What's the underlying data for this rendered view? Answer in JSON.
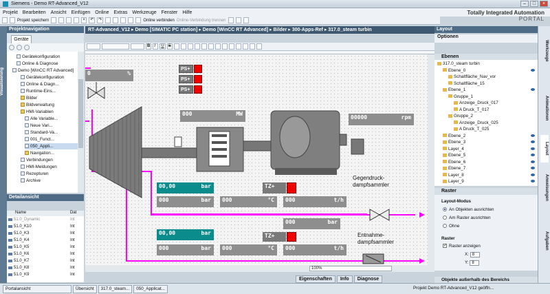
{
  "window": {
    "title": "Siemens - Demo RT-Advanced_V12"
  },
  "menu": [
    "Projekt",
    "Bearbeiten",
    "Ansicht",
    "Einfügen",
    "Online",
    "Extras",
    "Werkzeuge",
    "Fenster",
    "Hilfe"
  ],
  "brand": {
    "line1": "Totally Integrated Automation",
    "line2": "PORTAL"
  },
  "toolbar": {
    "save": "Projekt speichern",
    "connect": "Online verbinden",
    "disconnect": "Online-Verbindung trennen"
  },
  "left_strip": "Visualisierung",
  "project_nav": {
    "title": "Projektnavigation",
    "tab": "Geräte",
    "tree": [
      {
        "label": "Gerätekonfiguration",
        "indent": 2,
        "icon": "device"
      },
      {
        "label": "Online & Diagnose",
        "indent": 2,
        "icon": "device"
      },
      {
        "label": "Demo [WinCC RT Advanced]",
        "indent": 1,
        "icon": "device"
      },
      {
        "label": "Gerätekonfiguration",
        "indent": 3,
        "icon": "device"
      },
      {
        "label": "Online & Diagn...",
        "indent": 3,
        "icon": "device"
      },
      {
        "label": "Runtime-Eins...",
        "indent": 3,
        "icon": "device"
      },
      {
        "label": "Bilder",
        "indent": 3,
        "icon": "folder"
      },
      {
        "label": "Bildverwaltung",
        "indent": 3,
        "icon": "folder"
      },
      {
        "label": "HMI-Variablen",
        "indent": 3,
        "icon": "folder"
      },
      {
        "label": "Alle Variable...",
        "indent": 4,
        "icon": "device"
      },
      {
        "label": "Neue Vari...",
        "indent": 4,
        "icon": "device"
      },
      {
        "label": "Standard-Va...",
        "indent": 4,
        "icon": "device"
      },
      {
        "label": "001_Funct...",
        "indent": 4,
        "icon": "device"
      },
      {
        "label": "050_Appli...",
        "indent": 4,
        "icon": "device",
        "selected": true
      },
      {
        "label": "Navigation...",
        "indent": 4,
        "icon": "folder"
      },
      {
        "label": "Verbindungen",
        "indent": 3,
        "icon": "device"
      },
      {
        "label": "HMI-Meldungen",
        "indent": 3,
        "icon": "device"
      },
      {
        "label": "Rezepturen",
        "indent": 3,
        "icon": "device"
      },
      {
        "label": "Archive",
        "indent": 3,
        "icon": "device"
      }
    ]
  },
  "detail": {
    "title": "Detailansicht",
    "col_name": "Name",
    "col_type": "Dat",
    "rows": [
      {
        "name": "51.0_Dynamic",
        "type": "Int"
      },
      {
        "name": "51.0_K10",
        "type": "Int"
      },
      {
        "name": "51.0_K3",
        "type": "Int"
      },
      {
        "name": "51.0_K4",
        "type": "Int"
      },
      {
        "name": "51.0_K5",
        "type": "Int"
      },
      {
        "name": "51.0_K6",
        "type": "Int"
      },
      {
        "name": "51.0_K7",
        "type": "Int"
      },
      {
        "name": "51.0_K8",
        "type": "Int"
      },
      {
        "name": "51.0_K9",
        "type": "Int"
      }
    ]
  },
  "breadcrumb": "RT-Advanced_V12  ▸  Demo [SIMATIC PC station]  ▸  Demo [WinCC RT Advanced]  ▸  Bilder  ▸  300-Apps-Ref  ▸  317.0_steam turbin",
  "fmt": {
    "bold": "B",
    "italic": "I",
    "underline": "U",
    "strike": "S"
  },
  "zoom": "100%",
  "bottom_tabs": [
    "Eigenschaften",
    "Info",
    "Diagnose"
  ],
  "hmi": {
    "top_pct": {
      "value": "0",
      "unit": "%"
    },
    "ps_label": "PS+",
    "mw": {
      "value": "000",
      "unit": "MW"
    },
    "rpm": {
      "value": "00000",
      "unit": "rpm"
    },
    "gegendruck": "Gegendruck-\ndampfsammler",
    "entnahme": "Entnahme-\ndampfsammler",
    "tz_label": "TZ+",
    "row1": [
      {
        "value": "00,00",
        "unit": "bar"
      },
      {
        "value": "000",
        "unit": "bar"
      },
      {
        "value": "000",
        "unit": "°C"
      },
      {
        "value": "000",
        "unit": "t/h"
      }
    ],
    "mid_bar": {
      "value": "000",
      "unit": "bar"
    },
    "row2": [
      {
        "value": "00,00",
        "unit": "bar"
      },
      {
        "value": "000",
        "unit": "bar"
      },
      {
        "value": "000",
        "unit": "°C"
      },
      {
        "value": "000",
        "unit": "t/h"
      }
    ]
  },
  "layout_panel": {
    "title": "Layout",
    "options": "Optionen",
    "ebenen": "Ebenen",
    "layers": [
      {
        "label": "317.0_steam turbin",
        "indent": 0,
        "eye": false
      },
      {
        "label": "Ebene_0",
        "indent": 1,
        "eye": true
      },
      {
        "label": "Schaltfläche_Nav_vor",
        "indent": 2,
        "eye": false
      },
      {
        "label": "Schaltfläche_15",
        "indent": 2,
        "eye": false
      },
      {
        "label": "Ebene_1",
        "indent": 1,
        "eye": true
      },
      {
        "label": "Gruppe_1",
        "indent": 2,
        "eye": false
      },
      {
        "label": "Anzeige_Druck_017",
        "indent": 3,
        "eye": false
      },
      {
        "label": "A Druck_T_017",
        "indent": 3,
        "eye": false
      },
      {
        "label": "Gruppe_2",
        "indent": 2,
        "eye": false
      },
      {
        "label": "Anzeige_Druck_025",
        "indent": 3,
        "eye": false
      },
      {
        "label": "A Druck_T_025",
        "indent": 3,
        "eye": false
      },
      {
        "label": "Ebene_2",
        "indent": 1,
        "eye": true
      },
      {
        "label": "Ebene_3",
        "indent": 1,
        "eye": true
      },
      {
        "label": "Layer_4",
        "indent": 1,
        "eye": true
      },
      {
        "label": "Ebene_5",
        "indent": 1,
        "eye": true
      },
      {
        "label": "Ebene_6",
        "indent": 1,
        "eye": true
      },
      {
        "label": "Ebene_7",
        "indent": 1,
        "eye": true
      },
      {
        "label": "Layer_8",
        "indent": 1,
        "eye": true
      },
      {
        "label": "Layer_9",
        "indent": 1,
        "eye": true
      }
    ],
    "raster": "Raster",
    "layout_mode": "Layout-Modus",
    "opt_objects": "An Objekten ausrichten",
    "opt_grid": "Am Raster ausrichten",
    "opt_none": "Ohne",
    "raster_title": "Raster",
    "show_grid": "Raster anzeigen",
    "x_label": "X:",
    "x_val": "8",
    "y_label": "Y:",
    "y_val": "8",
    "outside": "Objekte außerhalb des Bereichs"
  },
  "right_tabs": [
    "Werkzeuge",
    "Animationen",
    "Layout",
    "Anweisungen",
    "Aufgaben"
  ],
  "status": {
    "portal": "Portalansicht",
    "overview": "Übersicht",
    "tab1": "317.0_steam...",
    "tab2": "050_Applicat...",
    "message": "Projekt Demo RT-Advanced_V12 geöffn..."
  },
  "colors": {
    "accent_dark": "#3e5871",
    "teal": "#0a8c8c",
    "magenta": "#ff00ff",
    "red": "#e00000"
  }
}
